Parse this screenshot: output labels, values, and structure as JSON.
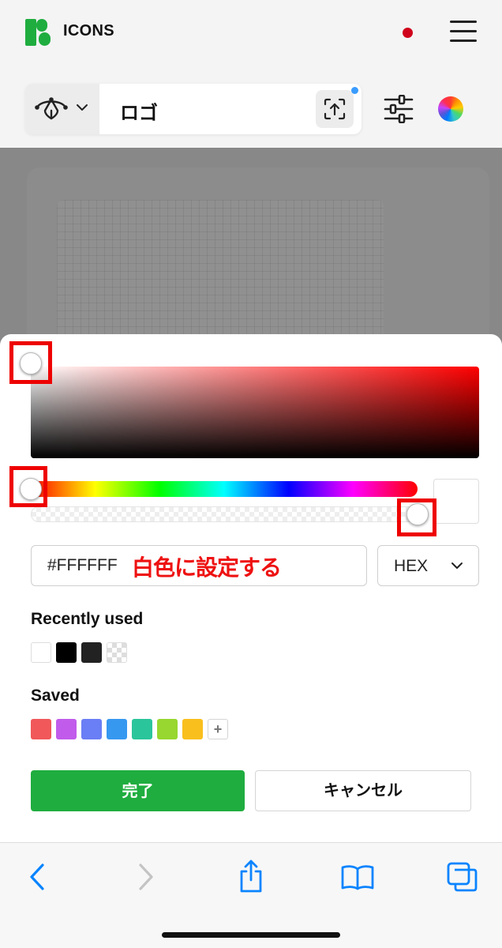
{
  "header": {
    "logo_text": "ICONS",
    "search_query": "ロゴ",
    "icons": {
      "logo": "icons8-logo",
      "notification": "red-dot",
      "menu": "hamburger-icon",
      "vector_mode": "bezier-pen-icon",
      "upload": "upload-image-icon",
      "filters": "sliders-icon",
      "color": "color-wheel-icon"
    }
  },
  "color_picker": {
    "hue_color": "#FF0000",
    "hex_value": "#FFFFFF",
    "annotation": "白色に設定する",
    "format": "HEX",
    "recent_title": "Recently used",
    "recent_colors": [
      "#FFFFFF",
      "#000000",
      "#222222",
      "transparent"
    ],
    "saved_title": "Saved",
    "saved_colors": [
      "#F0585A",
      "#C15BEB",
      "#6A7EF5",
      "#3798F0",
      "#2BC59B",
      "#97D72F",
      "#F9BF1D"
    ],
    "add_label": "+",
    "done_label": "完了",
    "cancel_label": "キャンセル",
    "highlight_color": "#EE0000",
    "done_color": "#1FAD3F"
  },
  "browser_toolbar": {
    "icons": [
      "back-icon",
      "forward-icon",
      "share-icon",
      "bookmarks-icon",
      "tabs-icon"
    ],
    "accent": "#0A84FF"
  }
}
